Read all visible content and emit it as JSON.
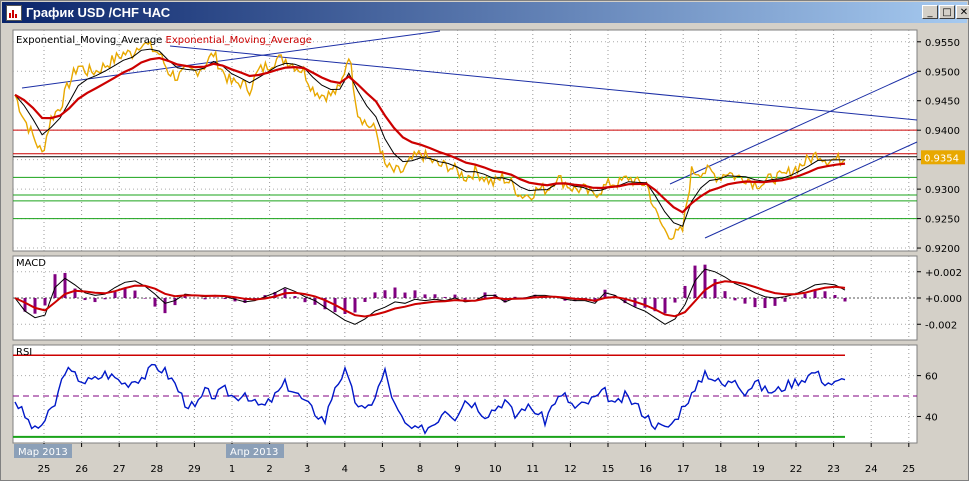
{
  "window": {
    "title": "График USD /CHF ЧАС",
    "minimize_glyph": "_",
    "maximize_glyph": "□",
    "close_glyph": "✕"
  },
  "colors": {
    "price": "#e8a800",
    "ema_fast": "#000000",
    "ema_slow": "#cc0000",
    "channel": "#1c2fa6",
    "support": "#1aa31a",
    "resistance": "#cc0000",
    "rsi": "#0018c8",
    "macd_hist": "#800080",
    "panel_bg": "#ffffff",
    "frame": "#d4d0c8"
  },
  "chart_data": [
    {
      "type": "line",
      "legend": [
        "Exponential_Moving_Average",
        "Exponential_Moving_Average"
      ],
      "ylim": [
        0.9195,
        0.957
      ],
      "yticks": [
        "0.9550",
        "0.9500",
        "0.9450",
        "0.9400",
        "0.9350",
        "0.9300",
        "0.9250",
        "0.9200"
      ],
      "last_price_label": "0.9354",
      "last_price": 0.9354,
      "horizontal_lines": {
        "resistance": [
          0.94,
          0.936
        ],
        "black": [
          0.9355
        ],
        "support": [
          0.932,
          0.929,
          0.928,
          0.925
        ]
      },
      "series": [
        {
          "values": [
            0.946,
            0.942,
            0.939,
            0.936,
            0.942,
            0.944,
            0.948,
            0.951,
            0.95,
            0.95,
            0.951,
            0.952,
            0.953,
            0.953,
            0.955,
            0.954,
            0.953,
            0.95,
            0.949,
            0.95,
            0.95,
            0.951,
            0.953,
            0.95,
            0.948,
            0.948,
            0.947,
            0.95,
            0.951,
            0.952,
            0.952,
            0.951,
            0.95,
            0.947,
            0.946,
            0.946,
            0.947,
            0.953,
            0.943,
            0.941,
            0.94,
            0.934,
            0.933,
            0.933,
            0.935,
            0.936,
            0.935,
            0.934,
            0.934,
            0.933,
            0.932,
            0.933,
            0.932,
            0.931,
            0.932,
            0.931,
            0.929,
            0.929,
            0.93,
            0.93,
            0.932,
            0.931,
            0.93,
            0.93,
            0.929,
            0.93,
            0.931,
            0.931,
            0.932,
            0.931,
            0.931,
            0.926,
            0.923,
            0.922,
            0.923,
            0.933,
            0.933,
            0.933,
            0.932,
            0.933,
            0.932,
            0.932,
            0.931,
            0.931,
            0.932,
            0.932,
            0.933,
            0.934,
            0.935,
            0.936,
            0.935,
            0.935,
            0.935
          ]
        }
      ]
    },
    {
      "type": "line",
      "title": "MACD",
      "ylim": [
        -0.0032,
        0.0032
      ],
      "yticks": [
        "+0.002",
        "+0.000",
        "-0.002"
      ],
      "series": [
        {
          "values": [
            0.0,
            -0.001,
            -0.0015,
            -0.0013,
            0.0008,
            0.0015,
            0.001,
            0.0004,
            0.0002,
            0.0003,
            0.0008,
            0.0012,
            0.0013,
            0.0009,
            0.0003,
            -0.0004,
            -0.0002,
            0.0003,
            0.0002,
            0.0001,
            0.0002,
            0.0001,
            -0.0001,
            -0.0003,
            -0.0002,
            0.0001,
            0.0004,
            0.0008,
            0.0005,
            0.0001,
            -0.0002,
            -0.0007,
            -0.0012,
            -0.0017,
            -0.002,
            -0.0016,
            -0.001,
            -0.0007,
            -0.0003,
            -0.0004,
            -0.0001,
            -0.0002,
            -0.0001,
            -0.0002,
            0.0,
            -0.0003,
            -0.0002,
            0.0002,
            0.0002,
            -0.0003,
            0.0,
            0.0,
            0.0002,
            0.0002,
            0.0001,
            -0.0001,
            -0.0002,
            -0.0002,
            -0.0004,
            0.0004,
            0.0002,
            -0.0003,
            -0.0007,
            -0.001,
            -0.0015,
            -0.002,
            -0.0016,
            -0.0005,
            0.0013,
            0.0022,
            0.002,
            0.0016,
            0.0011,
            0.0008,
            0.0004,
            0.0001,
            0.0,
            0.0001,
            0.0003,
            0.0006,
            0.001,
            0.0011,
            0.001,
            0.0006
          ]
        }
      ]
    },
    {
      "type": "line",
      "title": "RSI",
      "ylim": [
        27,
        75
      ],
      "yticks": [
        "60",
        "40"
      ],
      "levels": [
        70,
        50,
        30
      ],
      "series": [
        {
          "values": [
            48,
            40,
            33,
            38,
            46,
            63,
            60,
            57,
            58,
            61,
            59,
            56,
            58,
            60,
            65,
            62,
            56,
            47,
            44,
            52,
            50,
            53,
            49,
            52,
            46,
            45,
            50,
            56,
            52,
            47,
            42,
            38,
            55,
            62,
            48,
            42,
            50,
            62,
            45,
            36,
            33,
            34,
            37,
            44,
            40,
            48,
            46,
            41,
            44,
            48,
            40,
            45,
            43,
            38,
            48,
            50,
            44,
            46,
            49,
            52,
            45,
            50,
            46,
            41,
            36,
            34,
            38,
            47,
            52,
            62,
            58,
            55,
            59,
            52,
            57,
            53,
            52,
            55,
            57,
            59,
            62,
            57,
            56,
            58
          ]
        }
      ]
    }
  ],
  "x_axis": {
    "ticks": [
      "25",
      "26",
      "27",
      "28",
      "29",
      "1",
      "2",
      "3",
      "4",
      "5",
      "8",
      "9",
      "10",
      "11",
      "12",
      "15",
      "16",
      "17",
      "18",
      "19",
      "22",
      "23",
      "24",
      "25"
    ],
    "month_labels": [
      "Мар 2013",
      "Апр 2013"
    ]
  }
}
